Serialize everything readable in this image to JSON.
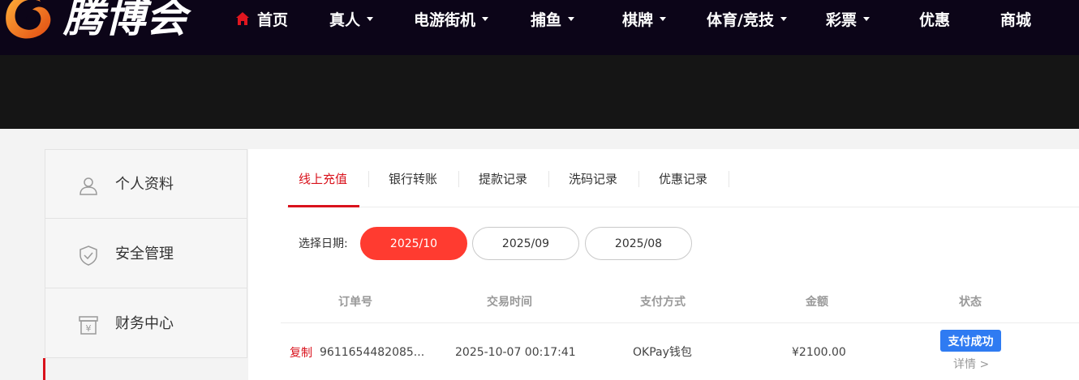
{
  "brand": {
    "name": "腾博会",
    "logo_icon": "phoenix-logo-icon",
    "accent": "#e8661a"
  },
  "nav": {
    "items": [
      {
        "label": "首页",
        "icon": "home-icon",
        "has_caret": false
      },
      {
        "label": "真人",
        "has_caret": true
      },
      {
        "label": "电游街机",
        "has_caret": true
      },
      {
        "label": "捕鱼",
        "has_caret": true
      },
      {
        "label": "棋牌",
        "has_caret": true
      },
      {
        "label": "体育/竞技",
        "has_caret": true
      },
      {
        "label": "彩票",
        "has_caret": true
      },
      {
        "label": "优惠",
        "has_caret": false
      },
      {
        "label": "商城",
        "has_caret": false
      }
    ]
  },
  "sidebar": {
    "items": [
      {
        "label": "个人资料",
        "icon": "user-icon"
      },
      {
        "label": "安全管理",
        "icon": "shield-icon"
      },
      {
        "label": "财务中心",
        "icon": "finance-icon"
      }
    ]
  },
  "tabs": {
    "items": [
      "线上充值",
      "银行转账",
      "提款记录",
      "洗码记录",
      "优惠记录"
    ],
    "active": "线上充值"
  },
  "date_filter": {
    "label": "选择日期:",
    "options": [
      "2025/10",
      "2025/09",
      "2025/08"
    ],
    "selected": "2025/10"
  },
  "table": {
    "headers": [
      "订单号",
      "交易时间",
      "支付方式",
      "金额",
      "状态"
    ],
    "rows": [
      {
        "copy_label": "复制",
        "order_no": "9611654482085...",
        "time": "2025-10-07 00:17:41",
        "method": "OKPay钱包",
        "amount": "¥2100.00",
        "status": "支付成功",
        "detail": "详情 >"
      }
    ]
  },
  "colors": {
    "nav_bg": "#0c0518",
    "accent_red": "#d9121c",
    "status_blue": "#2f7bf2",
    "date_active": "#ff3b30"
  }
}
